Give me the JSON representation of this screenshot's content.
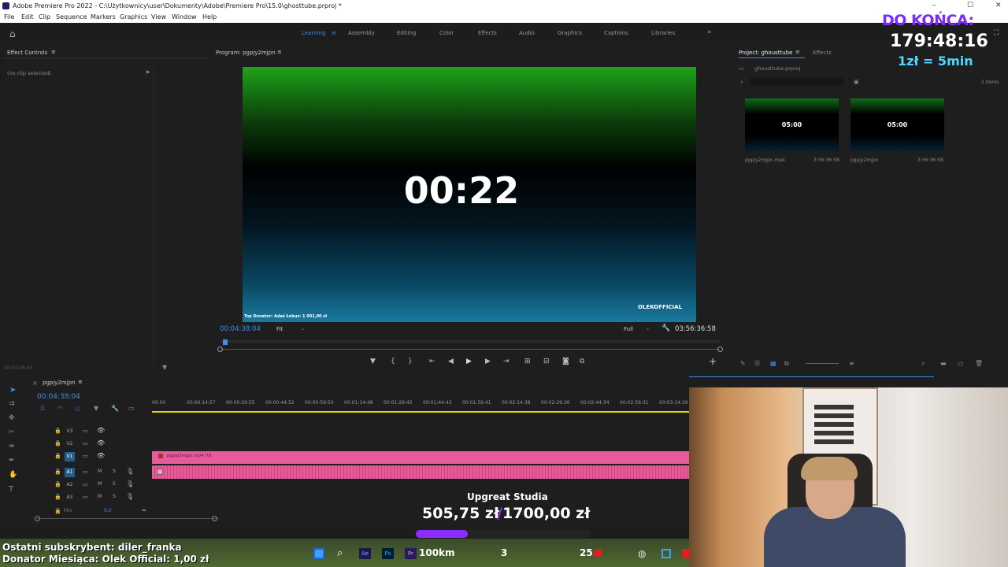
{
  "titlebar": {
    "title": "Adobe Premiere Pro 2022 - C:\\Użytkownicy\\user\\Dokumenty\\Adobe\\Premiere Pro\\15.0\\ghosttube.prproj *"
  },
  "menu": [
    "File",
    "Edit",
    "Clip",
    "Sequence",
    "Markers",
    "Graphics",
    "View",
    "Window",
    "Help"
  ],
  "workspaces": [
    "Learning",
    "Assembly",
    "Editing",
    "Color",
    "Effects",
    "Audio",
    "Graphics",
    "Captions",
    "Libraries"
  ],
  "effect_controls": {
    "title": "Effect Controls",
    "no_clip": "(no clip selected)",
    "timecode": "00:04:38:04"
  },
  "program": {
    "title": "Program: pgpjy2mjpn",
    "clock": "00:22",
    "top_donator": "Top Donator: Adaś Łobuz: 1 001,00 zł",
    "brand": "OLEKOFFICIAL",
    "timecode": "00:04:38:04",
    "fit": "Fit",
    "quality": "Full",
    "duration": "03:56:36:58"
  },
  "project": {
    "tab1": "Project: ghousttube",
    "tab2": "Effects",
    "file": "ghousttube.prproj",
    "items_count": "2 items",
    "items": [
      {
        "name": "pgpjy2mjpn.mp4",
        "duration": "3:56:36:58",
        "thumb": "05:00"
      },
      {
        "name": "pgpjy2mjpn",
        "duration": "3:56:36:58",
        "thumb": "05:00"
      }
    ]
  },
  "timeline": {
    "seq": "pgpjy2mjpn",
    "timecode": "00:04:38:04",
    "ruler": [
      "00:00",
      "00:00:14:57",
      "00:00:29:55",
      "00:00:44:52",
      "00:00:59:50",
      "00:01:14:48",
      "00:01:29:45",
      "00:01:44:43",
      "00:01:59:41",
      "00:02:14:38",
      "00:02:29:36",
      "00:02:44:34",
      "00:02:59:31",
      "00:03:14:29"
    ],
    "tracks": [
      "V3",
      "V2",
      "V1",
      "A1",
      "A2",
      "A3"
    ],
    "mix": "Mix",
    "mix_val": "0,0",
    "clip_label": "pgpjy2mjpn.mp4 [V]"
  },
  "stream": {
    "do_konca": "DO KOŃCA:",
    "countdown": "179:48:16",
    "rate": "1zł = 5min",
    "goal_title": "Upgreat Studia",
    "goal_current": "505,75 zł",
    "goal_target": "1700,00 zł",
    "goal_fraction": 0.297,
    "last_sub": "Ostatni subskrybent: diler_franka",
    "donator": "Donator Miesiąca: Olek Official: 1,00 zł"
  },
  "taskbar": {
    "km": "100km",
    "n1": "3",
    "n2": "25"
  },
  "colors": {
    "accent": "#3d8fe4",
    "pink": "#e85b9a",
    "goal_purple": "#8b2cff",
    "cyan": "#4fd7ff"
  }
}
